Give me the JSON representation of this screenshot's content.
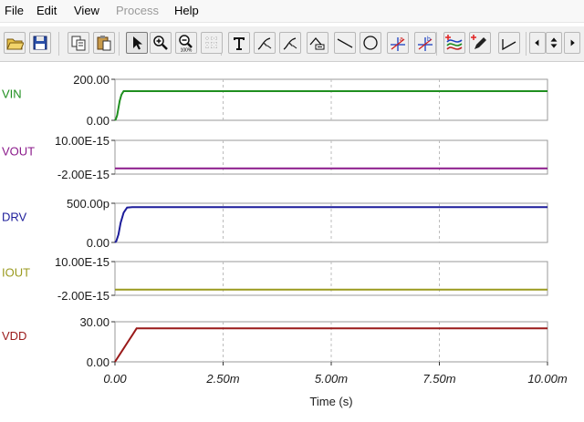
{
  "menu": [
    "File",
    "Edit",
    "View",
    "Process",
    "Help"
  ],
  "menu_disabled": [
    false,
    false,
    false,
    true,
    false
  ],
  "toolbar": {
    "buttons": [
      "open-file-icon",
      "save-icon",
      "copy-icon",
      "paste-icon",
      "select-arrow-icon",
      "zoom-in-icon",
      "zoom-100-icon",
      "grid-icon",
      "text-tool-icon",
      "cursor-a-icon",
      "cursor-b-icon",
      "measure-icon",
      "line-tool-icon",
      "circle-tool-icon",
      "cursor-a-crosshair-icon",
      "cursor-b-crosshair-icon",
      "curve-add-icon",
      "pen-icon",
      "step-tool-icon",
      "scroll-left-icon",
      "scroll-updown-icon",
      "scroll-right-icon"
    ],
    "zoom_label": "100%",
    "cursor_a": "a",
    "cursor_b": "b"
  },
  "chart_data": {
    "type": "line",
    "xlabel": "Time (s)",
    "xlim": [
      0,
      0.01
    ],
    "xticks": [
      "0.00",
      "2.50m",
      "5.00m",
      "7.50m",
      "10.00m"
    ],
    "grid": true,
    "series": [
      {
        "name": "VIN",
        "color": "#1f8f1f",
        "ytick_labels": [
          "200.00",
          "0.00"
        ],
        "ylim": [
          0,
          200
        ],
        "x": [
          0,
          2e-05,
          5e-05,
          8e-05,
          0.00011,
          0.00015,
          0.0002,
          0.0003,
          0.01
        ],
        "y": [
          0,
          5,
          25,
          60,
          95,
          125,
          142,
          142,
          142
        ]
      },
      {
        "name": "VOUT",
        "color": "#8b1a8b",
        "ytick_labels": [
          "10.00E-15",
          "-2.00E-15"
        ],
        "ylim": [
          -2e-15,
          1e-14
        ],
        "x": [
          0,
          0.01
        ],
        "y": [
          0,
          0
        ]
      },
      {
        "name": "DRV",
        "color": "#1c1c9a",
        "ytick_labels": [
          "500.00p",
          "0.00"
        ],
        "ylim": [
          0,
          5e-10
        ],
        "x": [
          0,
          3e-05,
          8e-05,
          0.00013,
          0.0002,
          0.00028,
          0.0004,
          0.01
        ],
        "y": [
          0,
          1.5e-11,
          1e-10,
          2.5e-10,
          3.8e-10,
          4.45e-10,
          4.5e-10,
          4.5e-10
        ]
      },
      {
        "name": "IOUT",
        "color": "#9a9a1f",
        "ytick_labels": [
          "10.00E-15",
          "-2.00E-15"
        ],
        "ylim": [
          -2e-15,
          1e-14
        ],
        "x": [
          0,
          0.01
        ],
        "y": [
          0,
          0
        ]
      },
      {
        "name": "VDD",
        "color": "#9a1a1a",
        "ytick_labels": [
          "30.00",
          "0.00"
        ],
        "ylim": [
          0,
          30
        ],
        "x": [
          0,
          0.0001,
          0.0002,
          0.0003,
          0.0004,
          0.0005,
          0.01
        ],
        "y": [
          0,
          5,
          10,
          15,
          20,
          25,
          25
        ]
      }
    ]
  }
}
